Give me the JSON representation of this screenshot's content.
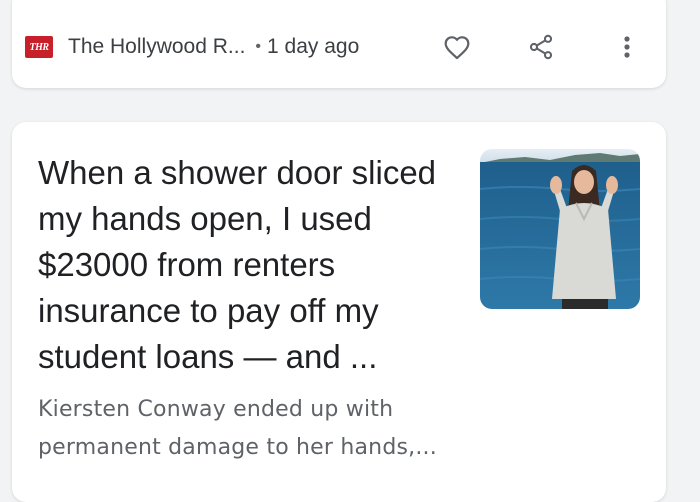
{
  "source": {
    "logo_text": "THR",
    "name": "The Hollywood R...",
    "separator": "•",
    "time": "1 day ago"
  },
  "actions": {
    "like_icon": "heart-outline-icon",
    "share_icon": "share-icon",
    "more_icon": "more-vert-icon"
  },
  "article": {
    "headline": "When a shower door sliced my hands open, I used $23000 from renters insurance to pay off my student loans — and ...",
    "snippet": "Kiersten Conway ended up with permanent damage to her hands,..."
  },
  "colors": {
    "brand_red": "#c8202b",
    "icon_gray": "#5f6368",
    "page_bg": "#f1f3f4"
  }
}
